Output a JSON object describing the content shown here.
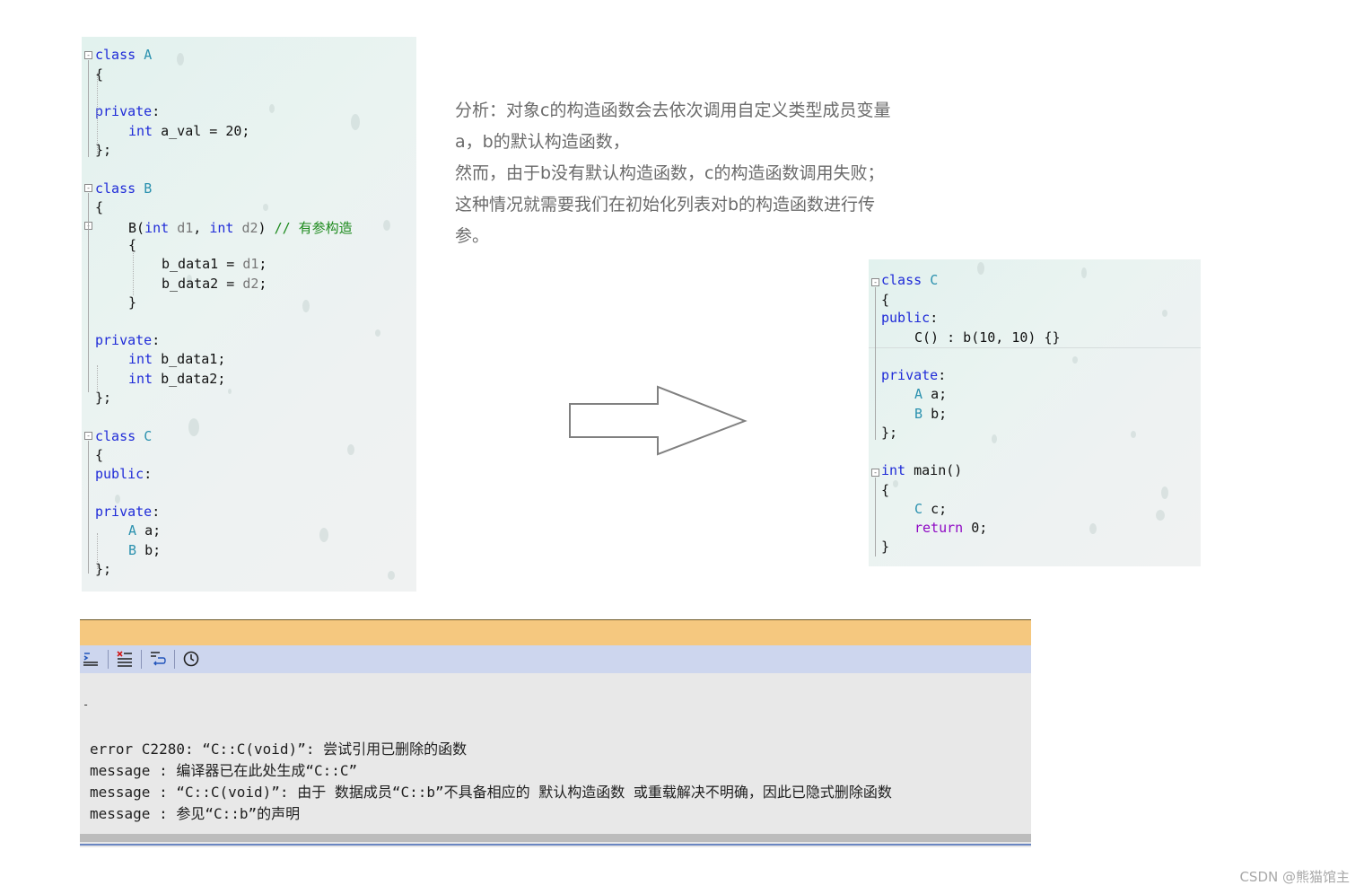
{
  "left_code": {
    "lines": [
      {
        "t": "class",
        "n": "A"
      },
      {
        "t": "brace_open"
      },
      {
        "t": "access",
        "kw": "private"
      },
      {
        "t": "member",
        "kw": "int",
        "name": "a_val = 20;"
      },
      {
        "t": "brace_close"
      },
      {
        "t": "class",
        "n": "B"
      },
      {
        "t": "brace_open"
      },
      {
        "t": "ctor",
        "fn": "B(",
        "kw1": "int",
        "p1": "d1",
        "kw2": "int",
        "p2": "d2",
        "comment": "// 有参构造"
      },
      {
        "t": "brace_open_inner"
      },
      {
        "t": "assign",
        "lhs": "b_data1 = ",
        "rhs": "d1"
      },
      {
        "t": "assign",
        "lhs": "b_data2 = ",
        "rhs": "d2"
      },
      {
        "t": "brace_close_inner"
      },
      {
        "t": "access",
        "kw": "private"
      },
      {
        "t": "member",
        "kw": "int",
        "name": "b_data1;"
      },
      {
        "t": "member",
        "kw": "int",
        "name": "b_data2;"
      },
      {
        "t": "brace_close"
      },
      {
        "t": "class",
        "n": "C"
      },
      {
        "t": "brace_open"
      },
      {
        "t": "access",
        "kw": "public"
      },
      {
        "t": "access",
        "kw": "private"
      },
      {
        "t": "typed_member",
        "ty": "A",
        "name": "a;"
      },
      {
        "t": "typed_member",
        "ty": "B",
        "name": "b;"
      },
      {
        "t": "brace_close"
      }
    ]
  },
  "analysis": {
    "lines": [
      "分析：对象c的构造函数会去依次调用自定义类型成员变量",
      "a，b的默认构造函数，",
      "然而，由于b没有默认构造函数，c的构造函数调用失败；",
      "这种情况就需要我们在初始化列表对b的构造函数进行传",
      "参。"
    ]
  },
  "right_code": {
    "class_kw": "class",
    "class_name": "C",
    "open_brace": "{",
    "public_kw": "public",
    "ctor_text": "C() : b(10, 10) {}",
    "private_kw": "private",
    "member_a_type": "A",
    "member_a_name": "a;",
    "member_b_type": "B",
    "member_b_name": "b;",
    "close_class": "};",
    "main_kw": "int",
    "main_name": "main()",
    "main_open": "{",
    "obj_type": "C",
    "obj_name": "c;",
    "return_kw": "return",
    "return_val": "0;",
    "main_close": "}"
  },
  "error_panel": {
    "dash": "-",
    "messages": [
      "error C2280: “C::C(void)”: 尝试引用已删除的函数",
      "message : 编译器已在此处生成“C::C”",
      "message : “C::C(void)”: 由于 数据成员“C::b”不具备相应的 默认构造函数 或重载解决不明确，因此已隐式删除函数",
      "message : 参见“C::b”的声明"
    ]
  },
  "watermark": "CSDN @熊猫馆主",
  "colors": {
    "keyword": "#1f2bd8",
    "type": "#2b91af",
    "comment": "#1c8a1c",
    "return_kw": "#8f08c4",
    "panel_top": "#f5c87f",
    "toolbar": "#cdd6ee"
  }
}
